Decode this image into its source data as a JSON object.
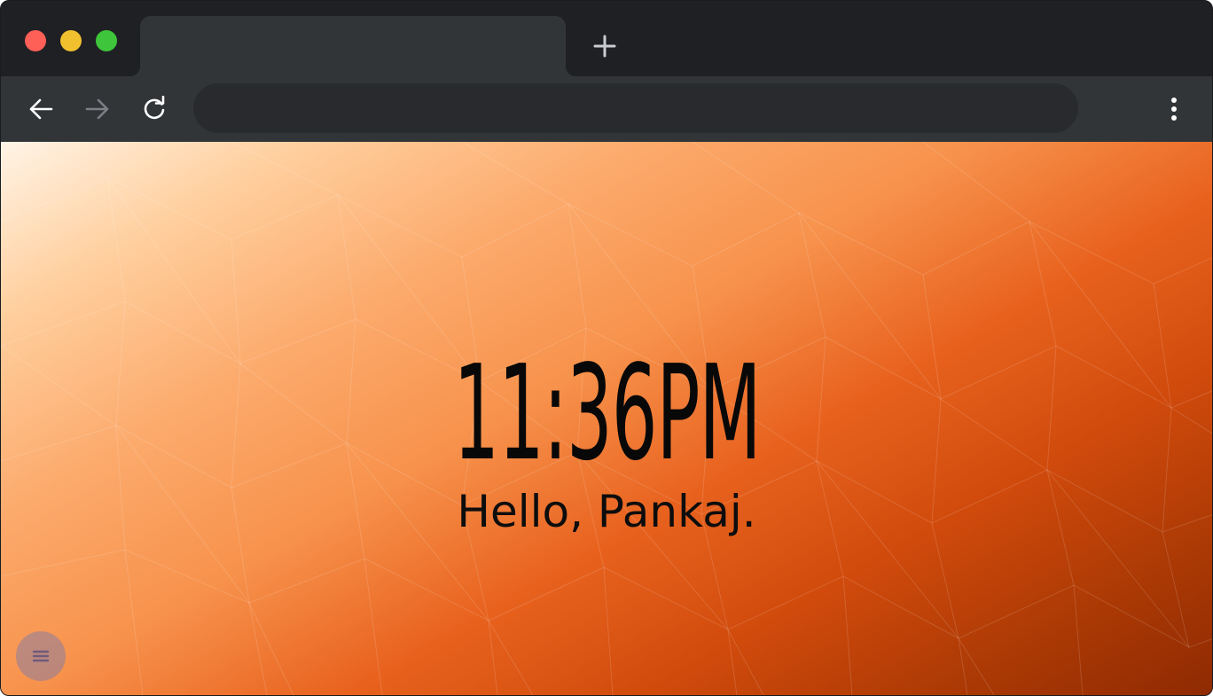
{
  "browser": {
    "tab": {
      "title": ""
    },
    "address_bar": {
      "value": "",
      "placeholder": ""
    },
    "icons": {
      "back": "arrow-left-icon",
      "forward": "arrow-right-icon",
      "reload": "reload-icon",
      "new_tab": "plus-icon",
      "menu": "vertical-dots-icon"
    },
    "forward_enabled": false
  },
  "page": {
    "time": "11:36PM",
    "greeting": "Hello, Pankaj.",
    "menu_button_icon": "hamburger-icon"
  },
  "colors": {
    "chrome_dark": "#1f2023",
    "chrome_toolbar": "#323538",
    "traffic_red": "#fe5f57",
    "traffic_yellow": "#f1c02f",
    "traffic_green": "#3ec53b",
    "background_light": "#fff4e6",
    "background_dark": "#8f2a02",
    "text": "#080808"
  }
}
